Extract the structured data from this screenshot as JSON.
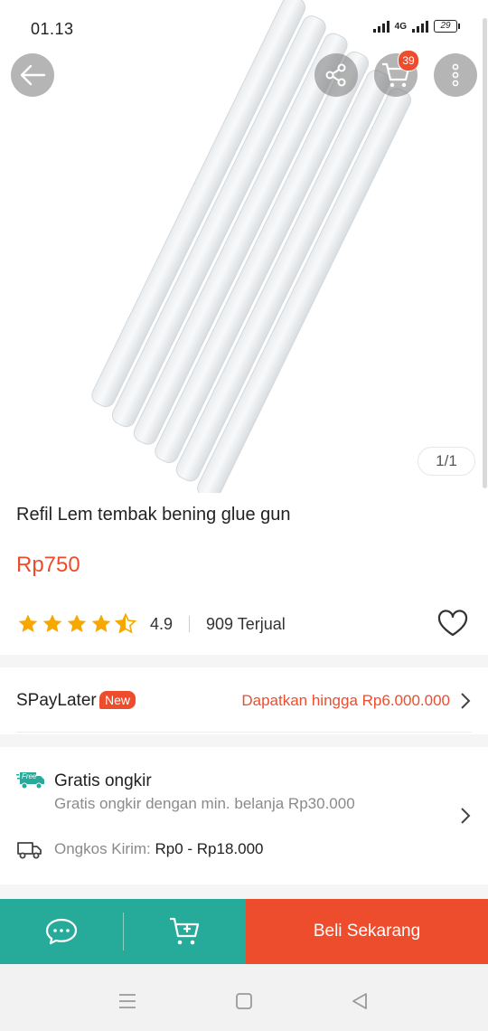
{
  "status_bar": {
    "time": "01.13",
    "network": "4G",
    "battery": "29"
  },
  "header": {
    "cart_count": "39",
    "back_icon": "arrow-left-icon",
    "share_icon": "share-icon",
    "cart_icon": "cart-icon",
    "more_icon": "more-vertical-icon"
  },
  "gallery": {
    "indicator": "1/1"
  },
  "product": {
    "title": "Refil Lem tembak bening glue gun",
    "price": "Rp750",
    "rating": "4.9",
    "sold": "909 Terjual"
  },
  "spaylater": {
    "label": "SPayLater",
    "badge": "New",
    "cta": "Dapatkan hingga Rp6.000.000"
  },
  "shipping": {
    "free_badge": "Free",
    "title": "Gratis ongkir",
    "subtitle": "Gratis ongkir dengan min. belanja Rp30.000",
    "cost_label": "Ongkos Kirim:",
    "cost_value": "Rp0 - Rp18.000"
  },
  "actions": {
    "buy_now": "Beli Sekarang"
  },
  "colors": {
    "accent": "#ee4d2d",
    "teal": "#26aa99"
  }
}
